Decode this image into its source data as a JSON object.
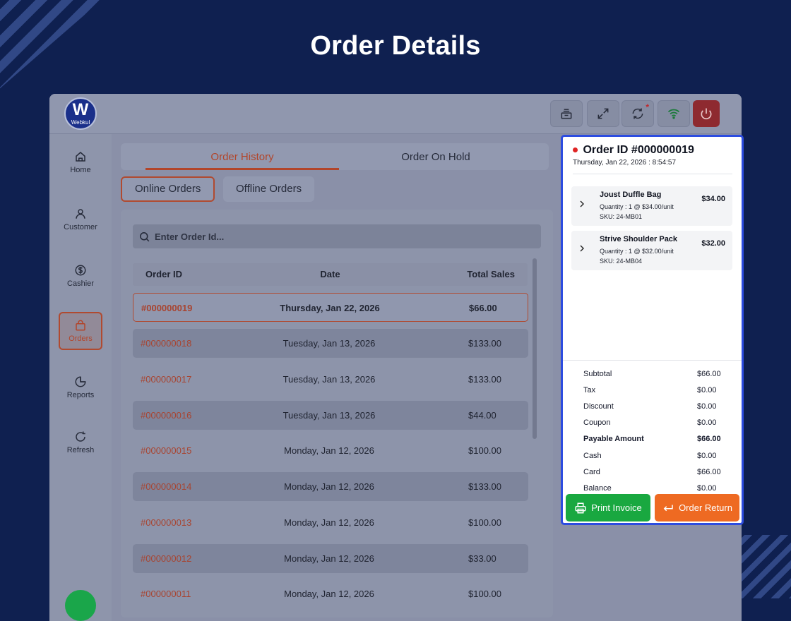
{
  "page": {
    "title": "Order Details"
  },
  "topbar": {
    "logo_letter": "W",
    "logo_text": "Webkul",
    "sync_badge": "*"
  },
  "sidebar": {
    "items": [
      {
        "label": "Home",
        "icon": "home-icon"
      },
      {
        "label": "Customer",
        "icon": "user-icon"
      },
      {
        "label": "Cashier",
        "icon": "dollar-icon"
      },
      {
        "label": "Orders",
        "icon": "bag-icon",
        "active": true
      },
      {
        "label": "Reports",
        "icon": "pie-chart-icon"
      },
      {
        "label": "Refresh",
        "icon": "refresh-icon"
      }
    ]
  },
  "tabs": {
    "order_history": "Order History",
    "order_on_hold": "Order On Hold"
  },
  "filters": {
    "online": "Online Orders",
    "offline": "Offline Orders"
  },
  "search": {
    "placeholder": "Enter Order Id..."
  },
  "table": {
    "headers": {
      "order_id": "Order ID",
      "date": "Date",
      "total": "Total Sales"
    },
    "rows": [
      {
        "id": "#000000019",
        "date": "Thursday, Jan 22, 2026",
        "total": "$66.00"
      },
      {
        "id": "#000000018",
        "date": "Tuesday, Jan 13, 2026",
        "total": "$133.00"
      },
      {
        "id": "#000000017",
        "date": "Tuesday, Jan 13, 2026",
        "total": "$133.00"
      },
      {
        "id": "#000000016",
        "date": "Tuesday, Jan 13, 2026",
        "total": "$44.00"
      },
      {
        "id": "#000000015",
        "date": "Monday, Jan 12, 2026",
        "total": "$100.00"
      },
      {
        "id": "#000000014",
        "date": "Monday, Jan 12, 2026",
        "total": "$133.00"
      },
      {
        "id": "#000000013",
        "date": "Monday, Jan 12, 2026",
        "total": "$100.00"
      },
      {
        "id": "#000000012",
        "date": "Monday, Jan 12, 2026",
        "total": "$33.00"
      },
      {
        "id": "#000000011",
        "date": "Monday, Jan 12, 2026",
        "total": "$100.00"
      }
    ]
  },
  "details": {
    "title": "Order ID #000000019",
    "datetime": "Thursday, Jan 22, 2026 : 8:54:57",
    "items": [
      {
        "name": "Joust Duffle Bag",
        "qty": "Quantity : 1 @ $34.00/unit",
        "sku": "SKU: 24-MB01",
        "price": "$34.00"
      },
      {
        "name": "Strive Shoulder Pack",
        "qty": "Quantity : 1 @ $32.00/unit",
        "sku": "SKU: 24-MB04",
        "price": "$32.00"
      }
    ],
    "totals": [
      {
        "label": "Subtotal",
        "value": "$66.00"
      },
      {
        "label": "Tax",
        "value": "$0.00"
      },
      {
        "label": "Discount",
        "value": "$0.00"
      },
      {
        "label": "Coupon",
        "value": "$0.00"
      },
      {
        "label": "Payable Amount",
        "value": "$66.00",
        "bold": true
      },
      {
        "label": "Cash",
        "value": "$0.00"
      },
      {
        "label": "Card",
        "value": "$66.00"
      },
      {
        "label": "Balance",
        "value": "$0.00"
      }
    ],
    "print_label": "Print Invoice",
    "return_label": "Order Return"
  },
  "colors": {
    "background": "#0f2050",
    "accent": "#b2452a",
    "details_border": "#2c4ce0",
    "print_button": "#19a840",
    "return_button": "#ee6a22",
    "power_button": "#8e2a30"
  }
}
